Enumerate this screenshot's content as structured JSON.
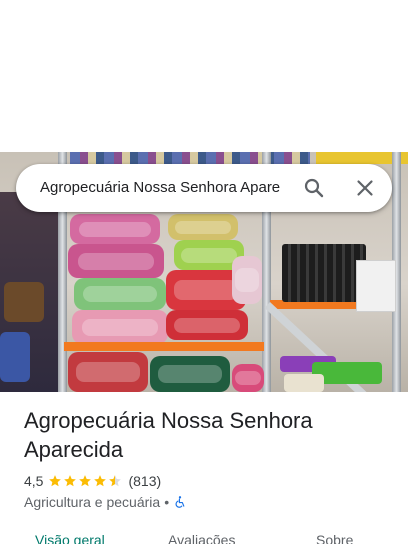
{
  "search": {
    "query": "Agropecuária Nossa Senhora Apare"
  },
  "place": {
    "title": "Agropecuária Nossa Senhora Aparecida",
    "rating": "4,5",
    "rating_value": 4.5,
    "reviews": "(813)",
    "category": "Agricultura e pecuária",
    "separator": "•"
  },
  "tabs": [
    {
      "label": "Visão geral",
      "active": true
    },
    {
      "label": "Avaliações",
      "active": false
    },
    {
      "label": "Sobre",
      "active": false
    }
  ],
  "colors": {
    "star": "#fbbc04",
    "star_empty": "#dadce0",
    "accessibility_icon": "#1a73e8",
    "active_tab": "#00796b"
  },
  "icons": {
    "search": "search-icon",
    "close": "close-icon",
    "star": "star-icon",
    "accessibility": "wheelchair-accessibility-icon"
  }
}
